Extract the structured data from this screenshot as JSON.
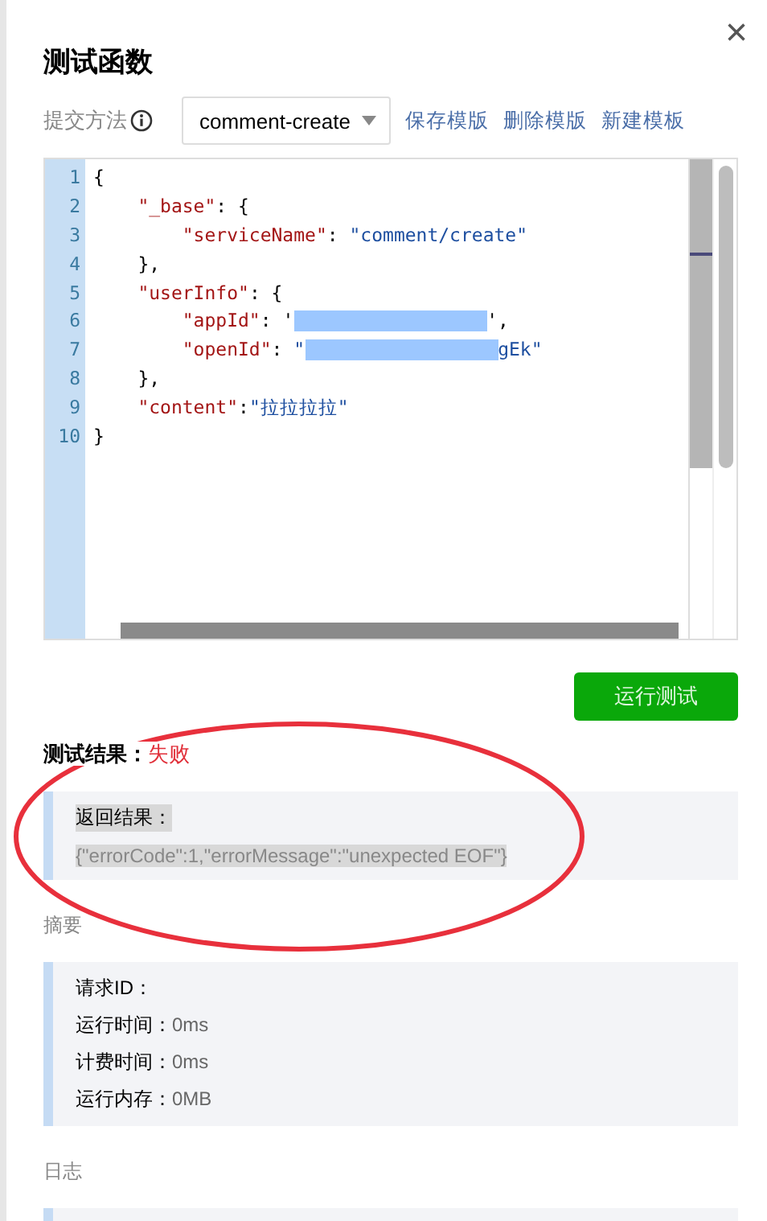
{
  "dialog": {
    "title": "测试函数",
    "close": "×"
  },
  "method": {
    "label": "提交方法",
    "selected_template": "comment-create",
    "links": [
      "保存模版",
      "删除模版",
      "新建模板"
    ]
  },
  "editor": {
    "lines": [
      {
        "number": "1",
        "parts": [
          {
            "kind": "punct",
            "text": "{"
          }
        ]
      },
      {
        "number": "2",
        "parts": [
          {
            "kind": "indent"
          },
          {
            "kind": "key",
            "text": "\"_base\""
          },
          {
            "kind": "punct",
            "text": ": {"
          }
        ]
      },
      {
        "number": "3",
        "parts": [
          {
            "kind": "indent"
          },
          {
            "kind": "indent"
          },
          {
            "kind": "key",
            "text": "\"serviceName\""
          },
          {
            "kind": "punct",
            "text": ": "
          },
          {
            "kind": "string",
            "text": "\"comment/create\""
          }
        ]
      },
      {
        "number": "4",
        "parts": [
          {
            "kind": "indent"
          },
          {
            "kind": "punct",
            "text": "},"
          }
        ]
      },
      {
        "number": "5",
        "parts": [
          {
            "kind": "indent"
          },
          {
            "kind": "key",
            "text": "\"userInfo\""
          },
          {
            "kind": "punct",
            "text": ": {"
          }
        ]
      },
      {
        "number": "6",
        "parts": [
          {
            "kind": "indent"
          },
          {
            "kind": "indent"
          },
          {
            "kind": "key",
            "text": "\"appId\""
          },
          {
            "kind": "punct",
            "text": ": '"
          },
          {
            "kind": "redacted"
          },
          {
            "kind": "punct",
            "text": "',"
          }
        ]
      },
      {
        "number": "7",
        "parts": [
          {
            "kind": "indent"
          },
          {
            "kind": "indent"
          },
          {
            "kind": "key",
            "text": "\"openId\""
          },
          {
            "kind": "punct",
            "text": ": "
          },
          {
            "kind": "string",
            "text": "\""
          },
          {
            "kind": "redacted"
          },
          {
            "kind": "string",
            "text": "gEk\""
          }
        ]
      },
      {
        "number": "8",
        "parts": [
          {
            "kind": "indent"
          },
          {
            "kind": "punct",
            "text": "},"
          }
        ]
      },
      {
        "number": "9",
        "parts": [
          {
            "kind": "indent"
          },
          {
            "kind": "key",
            "text": "\"content\""
          },
          {
            "kind": "punct",
            "text": ":"
          },
          {
            "kind": "string",
            "text": "\"拉拉拉拉\""
          }
        ]
      },
      {
        "number": "10",
        "parts": [
          {
            "kind": "punct",
            "text": "}"
          }
        ]
      }
    ]
  },
  "run_button": "运行测试",
  "result": {
    "label": "测试结果：",
    "status": "失败",
    "failed": true,
    "return_label": "返回结果：",
    "return_value": "{\"errorCode\":1,\"errorMessage\":\"unexpected EOF\"}",
    "highlighted": true
  },
  "summary": {
    "title": "摘要",
    "rows": [
      {
        "label": "请求ID：",
        "value": ""
      },
      {
        "label": "运行时间：",
        "value": "0ms"
      },
      {
        "label": "计费时间：",
        "value": "0ms"
      },
      {
        "label": "运行内存：",
        "value": "0MB"
      }
    ]
  },
  "log": {
    "title": "日志"
  }
}
